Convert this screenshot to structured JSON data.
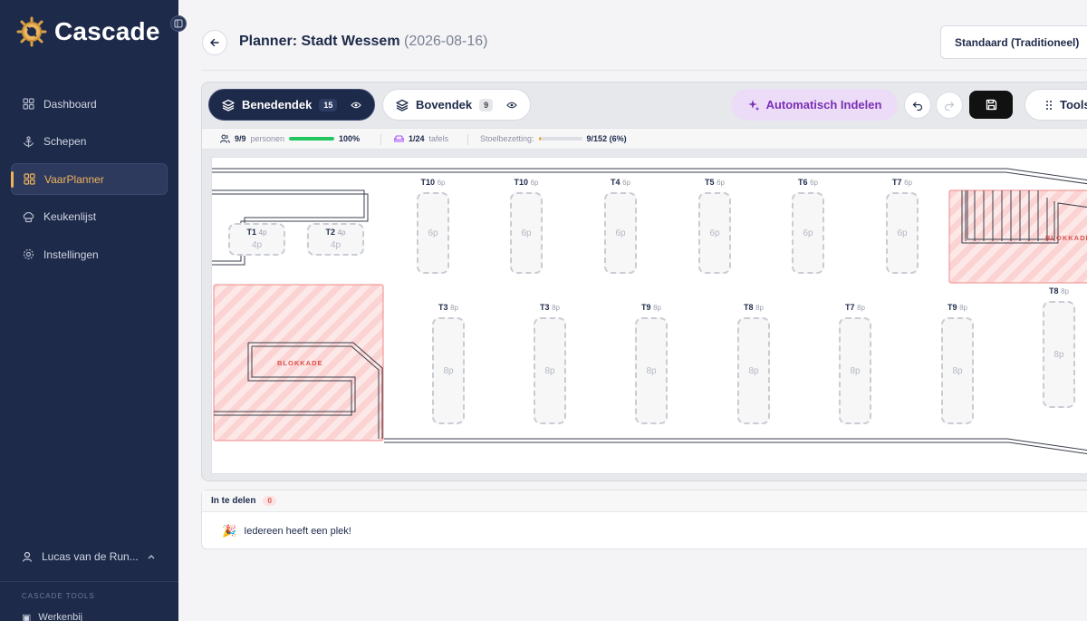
{
  "sidebar": {
    "brand": "Cascade",
    "items": [
      {
        "label": "Dashboard",
        "icon": "grid-icon"
      },
      {
        "label": "Schepen",
        "icon": "anchor-icon"
      },
      {
        "label": "VaarPlanner",
        "icon": "grid-icon",
        "active": true
      },
      {
        "label": "Keukenlijst",
        "icon": "chef-hat-icon"
      },
      {
        "label": "Instellingen",
        "icon": "gear-icon"
      }
    ],
    "user": "Lucas van de Run...",
    "tools_heading": "CASCADE TOOLS",
    "tools_link": "Werkenbij"
  },
  "header": {
    "title": "Planner: Stadt Wessem",
    "date": "(2026-08-16)",
    "layout_select": "Standaard (Traditioneel)"
  },
  "toolbar": {
    "deck_lower": {
      "label": "Benedendek",
      "count": "15"
    },
    "deck_upper": {
      "label": "Bovendek",
      "count": "9"
    },
    "auto_button": "Automatisch Indelen",
    "tools_button": "Tools"
  },
  "stats": {
    "persons": "9/9",
    "persons_label": "personen",
    "persons_pct": "100%",
    "persons_fill": 1.0,
    "tables": "1/24",
    "tables_label": "tafels",
    "seat_label": "Stoelbezetting:",
    "seat_value": "9/152 (6%)",
    "seat_fill": 0.06
  },
  "floor": {
    "blockade_label": "BLOKKADE",
    "tables": [
      {
        "name": "T1",
        "cap": "4p"
      },
      {
        "name": "T2",
        "cap": "4p"
      },
      {
        "name": "T10",
        "cap": "6p"
      },
      {
        "name": "T10",
        "cap": "6p"
      },
      {
        "name": "T4",
        "cap": "6p"
      },
      {
        "name": "T5",
        "cap": "6p"
      },
      {
        "name": "T6",
        "cap": "6p"
      },
      {
        "name": "T7",
        "cap": "6p"
      },
      {
        "name": "T3",
        "cap": "8p"
      },
      {
        "name": "T3",
        "cap": "8p"
      },
      {
        "name": "T9",
        "cap": "8p"
      },
      {
        "name": "T8",
        "cap": "8p"
      },
      {
        "name": "T7",
        "cap": "8p"
      },
      {
        "name": "T9",
        "cap": "8p"
      },
      {
        "name": "T8",
        "cap": "8p"
      }
    ]
  },
  "unassigned": {
    "title": "In te delen",
    "count": "0",
    "message": "Iedereen heeft een plek!"
  },
  "colors": {
    "sidebar_bg": "#1e2a4a",
    "accent_active": "#f0b35a",
    "auto_button_bg": "#ecdcf7",
    "auto_button_text": "#7a2fb6",
    "progress_green": "#22c55e",
    "seat_orange": "#f59e0b",
    "blockade_red": "#d9534f"
  }
}
